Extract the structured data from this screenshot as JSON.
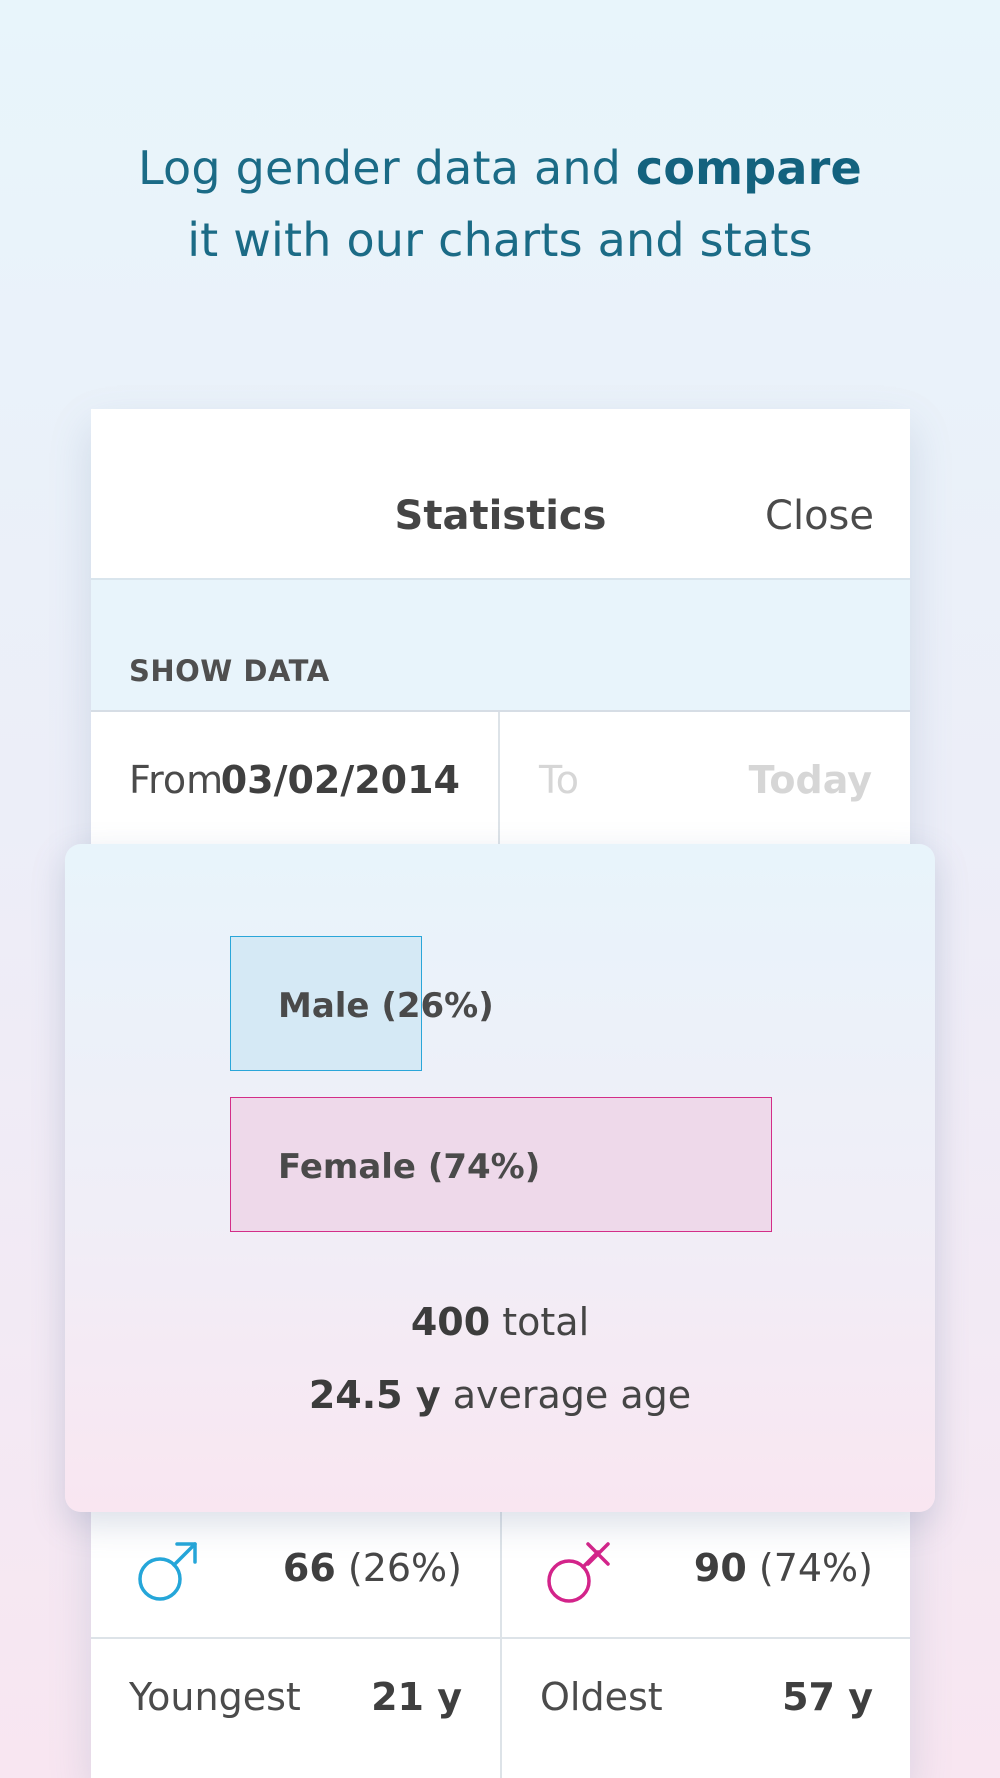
{
  "headline": {
    "line1_prefix": "Log gender data and ",
    "line1_bold": "compare",
    "line2": "it with our charts and stats"
  },
  "statistics_screen": {
    "title": "Statistics",
    "close_label": "Close",
    "section_label": "SHOW DATA",
    "range": {
      "from_label": "From",
      "from_value": "03/02/2014",
      "to_label": "To",
      "to_value": "Today"
    },
    "gender_stats": {
      "male": {
        "icon": "male-icon",
        "count": "66",
        "percent": "(26%)"
      },
      "female": {
        "icon": "female-icon",
        "count": "90",
        "percent": "(74%)"
      }
    },
    "age_stats": {
      "youngest_label": "Youngest",
      "youngest_value": "21 y",
      "oldest_label": "Oldest",
      "oldest_value": "57 y"
    }
  },
  "overlay_card": {
    "total_value": "400",
    "total_label": " total",
    "average_value": "24.5 y",
    "average_label": " average age"
  },
  "chart_data": {
    "type": "bar",
    "categories": [
      "Male",
      "Female"
    ],
    "values": [
      26,
      74
    ],
    "labels": [
      "Male (26%)",
      "Female (74%)"
    ],
    "colors": {
      "male_fill": "#d5e9f5",
      "male_stroke": "#2aa6d9",
      "female_fill": "#eed9ea",
      "female_stroke": "#d32d88"
    }
  },
  "colors": {
    "headline_text": "#1b6b86",
    "panel_background": "#ffffff",
    "section_band": "#e8f4fb",
    "male_icon": "#25a6d9",
    "female_icon": "#d3248a",
    "disabled_text": "#d6d6d6"
  }
}
